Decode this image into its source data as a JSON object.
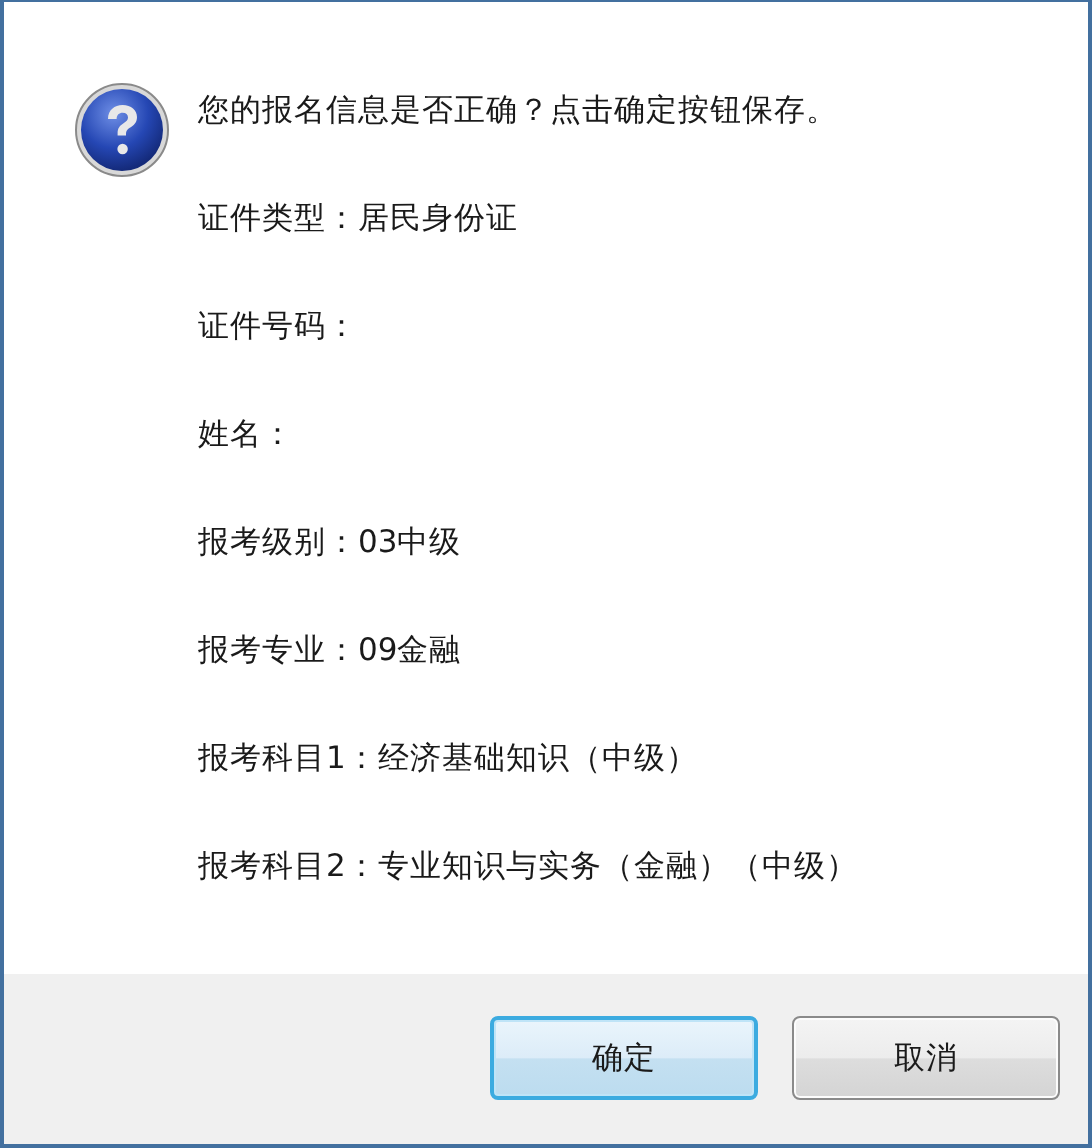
{
  "message": "您的报名信息是否正确？点击确定按钮保存。",
  "details": [
    "证件类型：居民身份证",
    "证件号码：",
    "姓名：",
    "报考级别：03中级",
    "报考专业：09金融",
    "报考科目1：经济基础知识（中级）",
    "报考科目2：专业知识与实务（金融）（中级）"
  ],
  "buttons": [
    {
      "label": "确定",
      "default": true
    },
    {
      "label": "取消",
      "default": false
    }
  ]
}
